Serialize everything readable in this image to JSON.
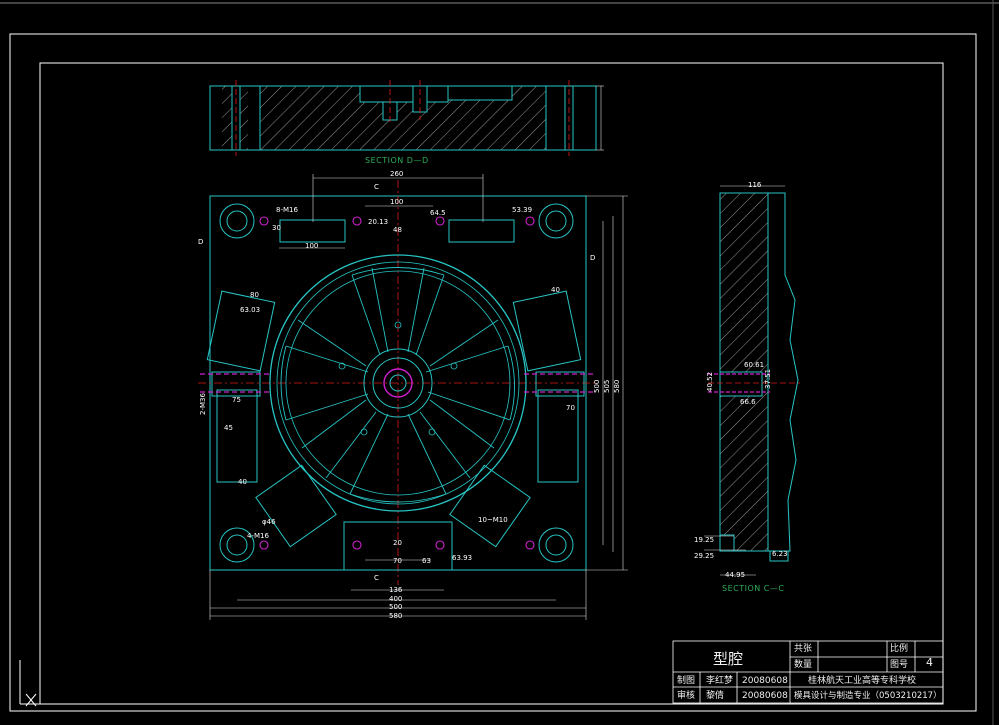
{
  "drawing": {
    "section_dd": "SECTION D—D",
    "section_cc": "SECTION C—C",
    "cut_c": "C",
    "cut_d": "D"
  },
  "dims": {
    "top_260": "260",
    "top_100": "100",
    "top_48": "48",
    "top_m16": "8-M16",
    "left_100": "100",
    "left_30": "30",
    "d2013": "20.13",
    "d6450": "64.5",
    "d5339": "53.39",
    "side_116": "116",
    "v500": "500",
    "v505": "505",
    "v580": "580",
    "side_6061": "60.61",
    "side_3751": "37.51",
    "side_4052": "40.52",
    "side_6660": "66.6",
    "b_1925": "19.25",
    "b_2925": "29.25",
    "b_4495": "44.95",
    "b_623": "6.23",
    "bot_20": "20",
    "bot_70": "70",
    "bot_63": "63",
    "bot_6393": "63.93",
    "bot_136": "136",
    "bot_400": "400",
    "bot_500": "500",
    "bot_580": "580",
    "m36": "2-M36",
    "l75": "75",
    "l45": "45",
    "l40": "40",
    "r70": "70",
    "a80": "80",
    "a63": "63.03",
    "a40": "40",
    "a_m16": "4-M16",
    "a_o46": "φ46",
    "a_5": "10~M10"
  },
  "title_block": {
    "title": "型腔",
    "total_sheets_label": "共张",
    "count_label": "数量",
    "scale_label": "比例",
    "sheet_no_label": "图号",
    "sheet_no": "4",
    "drawn_label": "制图",
    "drawn_name": "李红梦",
    "drawn_date": "20080608",
    "checked_label": "审核",
    "checked_name": "黎倩",
    "checked_date": "20080608",
    "school": "桂林航天工业高等专科学校",
    "major": "模具设计与制造专业（0503210217）"
  },
  "colors": {
    "frame": "#ffffff",
    "outline": "#27c4c4",
    "center": "#e01818",
    "dim": "#e0e0e0",
    "hidden": "#d020d0",
    "section_text": "#2fae5a"
  }
}
